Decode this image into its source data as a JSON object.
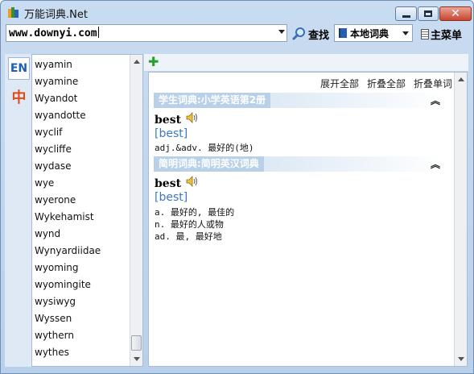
{
  "title": "万能词典.Net",
  "toolbar": {
    "query": "www.downyi.com",
    "search_label": "查找",
    "dict_selected": "本地词典",
    "menu_label": "主菜单"
  },
  "lang": {
    "en": "EN",
    "zh": "中"
  },
  "words": [
    "wyamin",
    "wyamine",
    "Wyandot",
    "wyandotte",
    "wyclif",
    "wycliffe",
    "wydase",
    "wye",
    "wyerone",
    "Wykehamist",
    "wynd",
    "Wynyardiidae",
    "wyoming",
    "wyomingite",
    "wysiwyg",
    "Wyssen",
    "wythern",
    "wythes"
  ],
  "controls": {
    "expand_all": "展开全部",
    "collapse_all": "折叠全部",
    "collapse_word": "折叠单词"
  },
  "sections": [
    {
      "title": "学生词典:小学英语第2册",
      "word": "best",
      "phonetic": "[best]",
      "defs": [
        "adj.&adv. 最好的(地)"
      ]
    },
    {
      "title": "简明词典:简明英汉词典",
      "word": "best",
      "phonetic": "[best]",
      "defs": [
        "a. 最好的, 最佳的",
        "n. 最好的人或物",
        "ad. 最, 最好地"
      ]
    }
  ],
  "colors": {
    "accent": "#3a78c0",
    "section_bg": "#b8d1e8",
    "chrome": "#c9dcf1"
  }
}
